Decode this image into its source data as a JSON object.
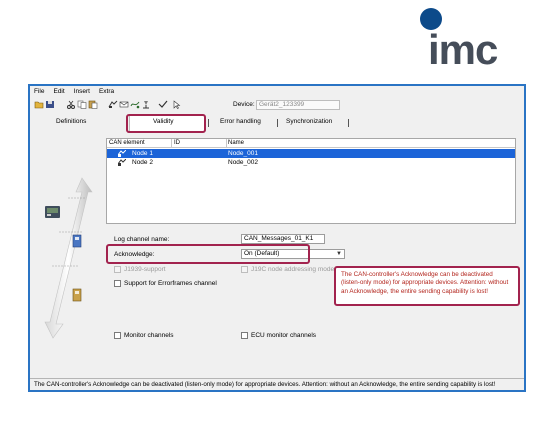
{
  "brand": {
    "logo_text": "imc",
    "dot_color": "#0c4a8a",
    "text_color": "#454d59"
  },
  "menu": [
    "File",
    "Edit",
    "Insert",
    "Extra"
  ],
  "toolbar": {
    "icons": [
      "open-icon",
      "save-icon",
      "cut-icon",
      "copy-icon",
      "paste-icon",
      "can-node-icon",
      "message-icon",
      "signal-icon",
      "measure-icon",
      "check-icon",
      "help-pointer-icon"
    ],
    "device_label": "Device:",
    "device_value": "Gerät2_123399"
  },
  "tabs": [
    "Definitions",
    "Validity",
    "Error handling",
    "Synchronization"
  ],
  "active_tab": "Validity",
  "list": {
    "columns": [
      "CAN element",
      "ID",
      "Name"
    ],
    "rows": [
      {
        "element": "Node 1",
        "id": "",
        "name": "Node_001",
        "selected": true
      },
      {
        "element": "Node 2",
        "id": "",
        "name": "Node_002",
        "selected": false
      }
    ]
  },
  "form": {
    "log_channel_label": "Log channel name:",
    "log_channel_value": "CAN_Messages_01_K1",
    "acknowledge_label": "Acknowledge:",
    "acknowledge_value": "On (Default)",
    "j1939_label": "J1939-support",
    "j1939_node_label": "J19C node addressing mode",
    "errorframes_label": "Support for Errorframes channel",
    "monitor_label": "Monitor channels",
    "ecu_monitor_label": "ECU monitor channels"
  },
  "tooltip": "The CAN-controller's Acknowledge can be deactivated (listen-only mode) for appropriate devices. Attention: without an Acknowledge, the entire sending capability is lost!",
  "status": "The CAN-controller's Acknowledge can be deactivated (listen-only mode) for appropriate devices. Attention: without an Acknowledge, the entire sending capability is lost!",
  "colors": {
    "highlight": "#a2234e",
    "selection": "#1c64d8",
    "window_border": "#2a74c4",
    "tooltip_text": "#b3261e"
  }
}
